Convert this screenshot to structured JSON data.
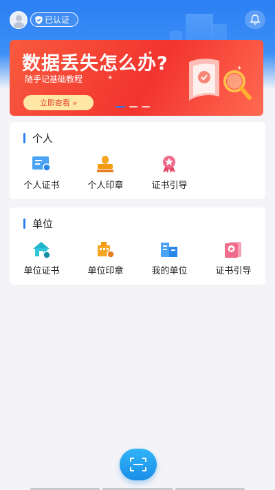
{
  "header": {
    "avatar_icon": "user-avatar-icon",
    "verified_label": "已认证",
    "verified_icon": "shield-check-icon",
    "bell_icon": "bell-icon"
  },
  "banner": {
    "title": "数据丢失怎么办?",
    "subtitle": "随手记基础教程",
    "button_label": "立即查看 »",
    "pages": 3,
    "active_page": 1,
    "accent": "#f2342f"
  },
  "personal": {
    "title": "个人",
    "items": [
      {
        "label": "个人证书",
        "icon": "personal-certificate-icon"
      },
      {
        "label": "个人印章",
        "icon": "personal-seal-icon"
      },
      {
        "label": "证书引导",
        "icon": "certificate-guide-icon"
      }
    ]
  },
  "unit": {
    "title": "单位",
    "items": [
      {
        "label": "单位证书",
        "icon": "unit-certificate-icon"
      },
      {
        "label": "单位印章",
        "icon": "unit-seal-icon"
      },
      {
        "label": "我的单位",
        "icon": "my-unit-icon"
      },
      {
        "label": "证书引导",
        "icon": "certificate-guide-icon"
      }
    ]
  },
  "bottom": {
    "scan_icon": "scan-icon"
  },
  "colors": {
    "primary": "#2b7ff2",
    "background": "#f4f4f8"
  }
}
